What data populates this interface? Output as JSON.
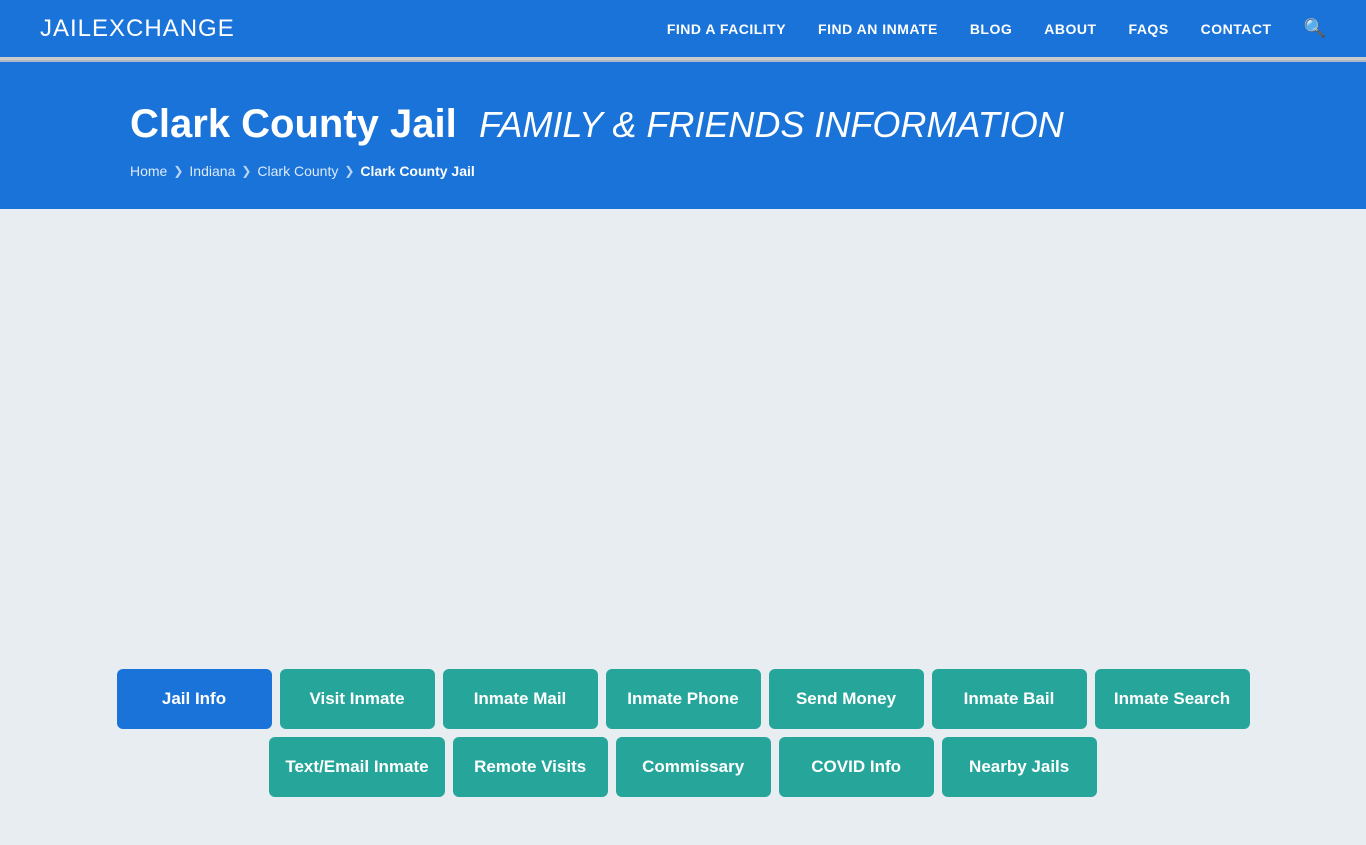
{
  "header": {
    "logo_bold": "JAIL",
    "logo_light": "EXCHANGE",
    "nav_items": [
      {
        "label": "FIND A FACILITY",
        "id": "find-facility"
      },
      {
        "label": "FIND AN INMATE",
        "id": "find-inmate"
      },
      {
        "label": "BLOG",
        "id": "blog"
      },
      {
        "label": "ABOUT",
        "id": "about"
      },
      {
        "label": "FAQs",
        "id": "faqs"
      },
      {
        "label": "CONTACT",
        "id": "contact"
      }
    ]
  },
  "hero": {
    "title_main": "Clark County Jail",
    "title_sub": "FAMILY & FRIENDS INFORMATION",
    "breadcrumb": [
      {
        "label": "Home",
        "id": "home"
      },
      {
        "label": "Indiana",
        "id": "indiana"
      },
      {
        "label": "Clark County",
        "id": "clark-county"
      },
      {
        "label": "Clark County Jail",
        "id": "clark-county-jail",
        "current": true
      }
    ]
  },
  "buttons_row1": [
    {
      "label": "Jail Info",
      "id": "jail-info",
      "active": true
    },
    {
      "label": "Visit Inmate",
      "id": "visit-inmate",
      "active": false
    },
    {
      "label": "Inmate Mail",
      "id": "inmate-mail",
      "active": false
    },
    {
      "label": "Inmate Phone",
      "id": "inmate-phone",
      "active": false
    },
    {
      "label": "Send Money",
      "id": "send-money",
      "active": false
    },
    {
      "label": "Inmate Bail",
      "id": "inmate-bail",
      "active": false
    },
    {
      "label": "Inmate Search",
      "id": "inmate-search",
      "active": false
    }
  ],
  "buttons_row2": [
    {
      "label": "Text/Email Inmate",
      "id": "text-email-inmate",
      "active": false
    },
    {
      "label": "Remote Visits",
      "id": "remote-visits",
      "active": false
    },
    {
      "label": "Commissary",
      "id": "commissary",
      "active": false
    },
    {
      "label": "COVID Info",
      "id": "covid-info",
      "active": false
    },
    {
      "label": "Nearby Jails",
      "id": "nearby-jails",
      "active": false
    }
  ]
}
